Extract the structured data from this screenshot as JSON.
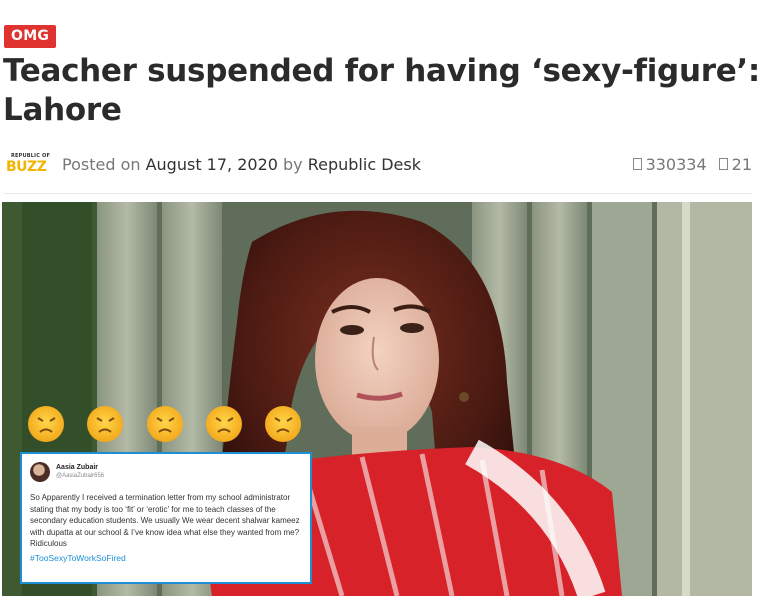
{
  "category_badge": "OMG",
  "article": {
    "title": "Teacher suspended for having ‘sexy-figure’: Lahore"
  },
  "meta": {
    "logo_small": "REPUBLIC OF",
    "logo_big": "BUZZ",
    "posted_on_label": "Posted on",
    "date": "August 17, 2020",
    "by_label": "by",
    "author": "Republic Desk",
    "views": "330334",
    "comments": "21"
  },
  "emoji_icon": "weary-face-emoji",
  "tweet": {
    "name": "Aasia Zubair",
    "handle": "@AasiaZubair656",
    "text": "So Apparently I received a termination letter from my school administrator stating that my body is too ‘fit’ or ‘erotic’ for me to teach classes of the secondary education students. We usually We wear decent shalwar kameez with dupatta at our school & I’ve know idea what else they wanted from me? Ridiculous",
    "hashtag": "#TooSexyToWorkSoFired"
  },
  "colors": {
    "badge": "#e0322f",
    "link": "#1d8fd6",
    "scarf_red": "#d8222a"
  }
}
